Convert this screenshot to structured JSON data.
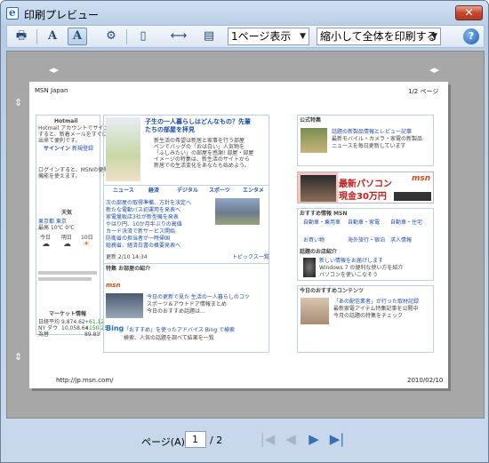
{
  "window": {
    "title": "印刷プレビュー",
    "close": "✕",
    "colors": {
      "accent": "#c8462d",
      "frame": "#b8cde6"
    }
  },
  "toolbar": {
    "print_icon": "🖶",
    "font_small_icon": "A",
    "font_large_icon": "A",
    "settings_icon": "⚙",
    "layout_icon": "▯",
    "fit_width_icon": "⟷",
    "headerfooter_icon": "▤",
    "view_select": "1ページ表示",
    "scale_select": "縮小して全体を印刷する",
    "help": "?"
  },
  "page": {
    "header_left": "MSN Japan",
    "header_right": "1/2 ページ",
    "footer_left": "http://jp.msn.com/",
    "footer_right": "2010/02/10",
    "left_col": {
      "box_title": "Hotmail",
      "lines": [
        "Hotmail アカウントでサインイン",
        "すると、新着メールをすぐに確認",
        "出来て便利です。"
      ],
      "signin": "サインイン",
      "register": "新規登録",
      "login_note": [
        "ログインすると、MSNの便利",
        "機能を使えます。"
      ],
      "weather_title": "天気",
      "weather_city": "東京都 東京",
      "weather_temp": "最高 10℃ 0℃",
      "weather_days": [
        "今日",
        "明日",
        "10日"
      ],
      "money_title": "マーケット情報",
      "money_rows": [
        {
          "name": "日経平均",
          "value": "9,874.62",
          "change": "+61.12"
        },
        {
          "name": "NY ダウ",
          "value": "10,058.64",
          "change": "+150.25"
        },
        {
          "name": "為替",
          "value": "",
          "change": "89.83"
        }
      ]
    },
    "center_col": {
      "headline": "子生の一人暮らしはどんなもの？先輩たちの部屋を拝見",
      "lede": [
        "新生活の希望は新居と家事を行う部屋",
        "ペンでバッグの「おは白い」人気物を",
        "「ふしみたい」の部屋を感謝! 部屋・部屋",
        "イメージの特集は、新生活のサイトから",
        "新居での生活変化をあなたも始めよう。"
      ],
      "tabs": [
        "ニュース",
        "経済",
        "デジタル",
        "スポーツ",
        "エンタメ"
      ],
      "news": [
        "次の部屋の取得準備、方針を決定へ",
        "新たな電動バス初運用を発表へ",
        "家電量販店3社が新型機を発表",
        "やはり円、10か月半ぶりの高値",
        "カード決済で新サービス開始",
        "防衛省の担当者が一時帰国",
        "総務省、経済白書の概要発表へ"
      ],
      "updated": "更新 2/10 14:34",
      "more": "トピックス一覧",
      "sub_title": "特集 お部屋の紹介",
      "msn_links": [
        "今日の更新で見た 生活の一人暮らしのコツ",
        "スポーツ＆アウトドア情報まとめ",
        "今日のおすすめ話題は..."
      ],
      "bing_title": "Bing",
      "bing_links": [
        "「おすすめ」を使ったアドバイス Bing で検索",
        "検索、人気の話題を調べて結果を一覧"
      ]
    },
    "right_col": {
      "top_title": "公式特集",
      "top_lines": [
        "話題の新製品情報とレビュー記事",
        "最新モバイル・カメラ・家電の新製品",
        "ニュースを毎日更新しています"
      ],
      "banner_line1": "最新パソコン",
      "banner_line2": "現金30万円",
      "banner_msn": "msn",
      "section_title": "おすすめ情報 MSN",
      "section_rows": [
        [
          "自動車・乗用車",
          "自動車・家電",
          "自動車・住宅"
        ],
        [
          "お買い物",
          "海外旅行・宿泊",
          "求人情報"
        ]
      ],
      "promo_title": "話題のお店紹介",
      "promo_lines": [
        "新しい情報をお届けします",
        "Windows 7 の便利な使い方を紹介",
        "パソコンを使いこなそう"
      ],
      "bottom_title": "今日のおすすめコンテンツ",
      "bottom_lines": [
        "「あの配信業者」が行った取材記録",
        "最新家電アイテム特集記事を公開中",
        "今月の話題の特集をチェック"
      ]
    }
  },
  "nav": {
    "page_label": "ページ(A)",
    "current_page": "1",
    "total_pages": "/ 2",
    "first": "|◀",
    "prev": "◀",
    "next": "▶",
    "last": "▶|"
  }
}
